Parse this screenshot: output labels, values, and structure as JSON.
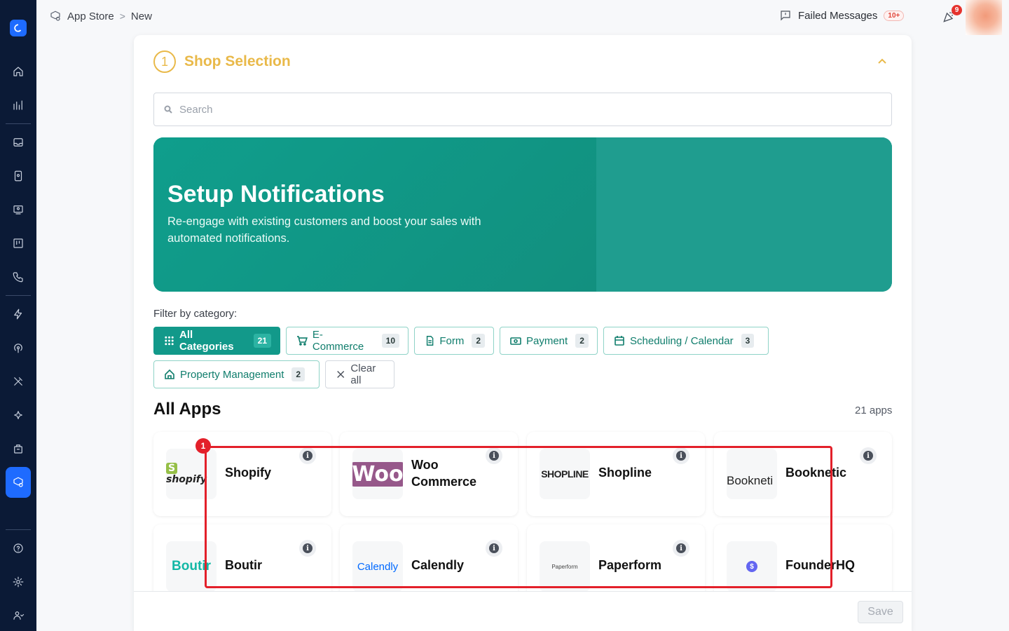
{
  "breadcrumb": {
    "root": "App Store",
    "sep": ">",
    "current": "New"
  },
  "topbar": {
    "failed_label": "Failed Messages",
    "failed_count": "10+",
    "bell_count": "9"
  },
  "sidebar": {
    "items": [
      "home-icon",
      "analytics-icon",
      "inbox-icon",
      "contacts-icon",
      "dashboard-icon",
      "kanban-icon",
      "phone-icon",
      "automation-icon",
      "broadcast-icon",
      "tools-icon",
      "ai-icon",
      "store-icon",
      "app-store-icon",
      "help-icon",
      "settings-icon",
      "team-icon"
    ]
  },
  "step": {
    "number": "1",
    "title": "Shop Selection"
  },
  "search": {
    "placeholder": "Search"
  },
  "banner": {
    "title": "Setup Notifications",
    "description": "Re-engage with existing customers and boost your sales with automated notifications."
  },
  "filter": {
    "label": "Filter by category:",
    "chips": [
      {
        "label": "All Categories",
        "count": "21"
      },
      {
        "label": "E-Commerce",
        "count": "10"
      },
      {
        "label": "Form",
        "count": "2"
      },
      {
        "label": "Payment",
        "count": "2"
      },
      {
        "label": "Scheduling / Calendar",
        "count": "3"
      },
      {
        "label": "Property Management",
        "count": "2"
      }
    ],
    "clear_label": "Clear all"
  },
  "apps": {
    "title": "All Apps",
    "count": "21 apps",
    "items": [
      {
        "name": "Shopify",
        "logo_text": "shopify"
      },
      {
        "name": "Woo Commerce",
        "logo_text": "Woo"
      },
      {
        "name": "Shopline",
        "logo_text": "SHOPLINE"
      },
      {
        "name": "Booknetic",
        "logo_text": "Bookneti"
      },
      {
        "name": "Boutir",
        "logo_text": "Boutir"
      },
      {
        "name": "Calendly",
        "logo_text": "Calendly"
      },
      {
        "name": "Paperform",
        "logo_text": "Paperform"
      },
      {
        "name": "FounderHQ",
        "logo_text": "$"
      }
    ]
  },
  "footer": {
    "save_label": "Save"
  },
  "annotation": {
    "number": "1"
  },
  "colors": {
    "accent": "#12998a",
    "step": "#e9b949",
    "sidebar": "#0b1a36",
    "active": "#1e6bff",
    "annotation": "#e3202a"
  }
}
